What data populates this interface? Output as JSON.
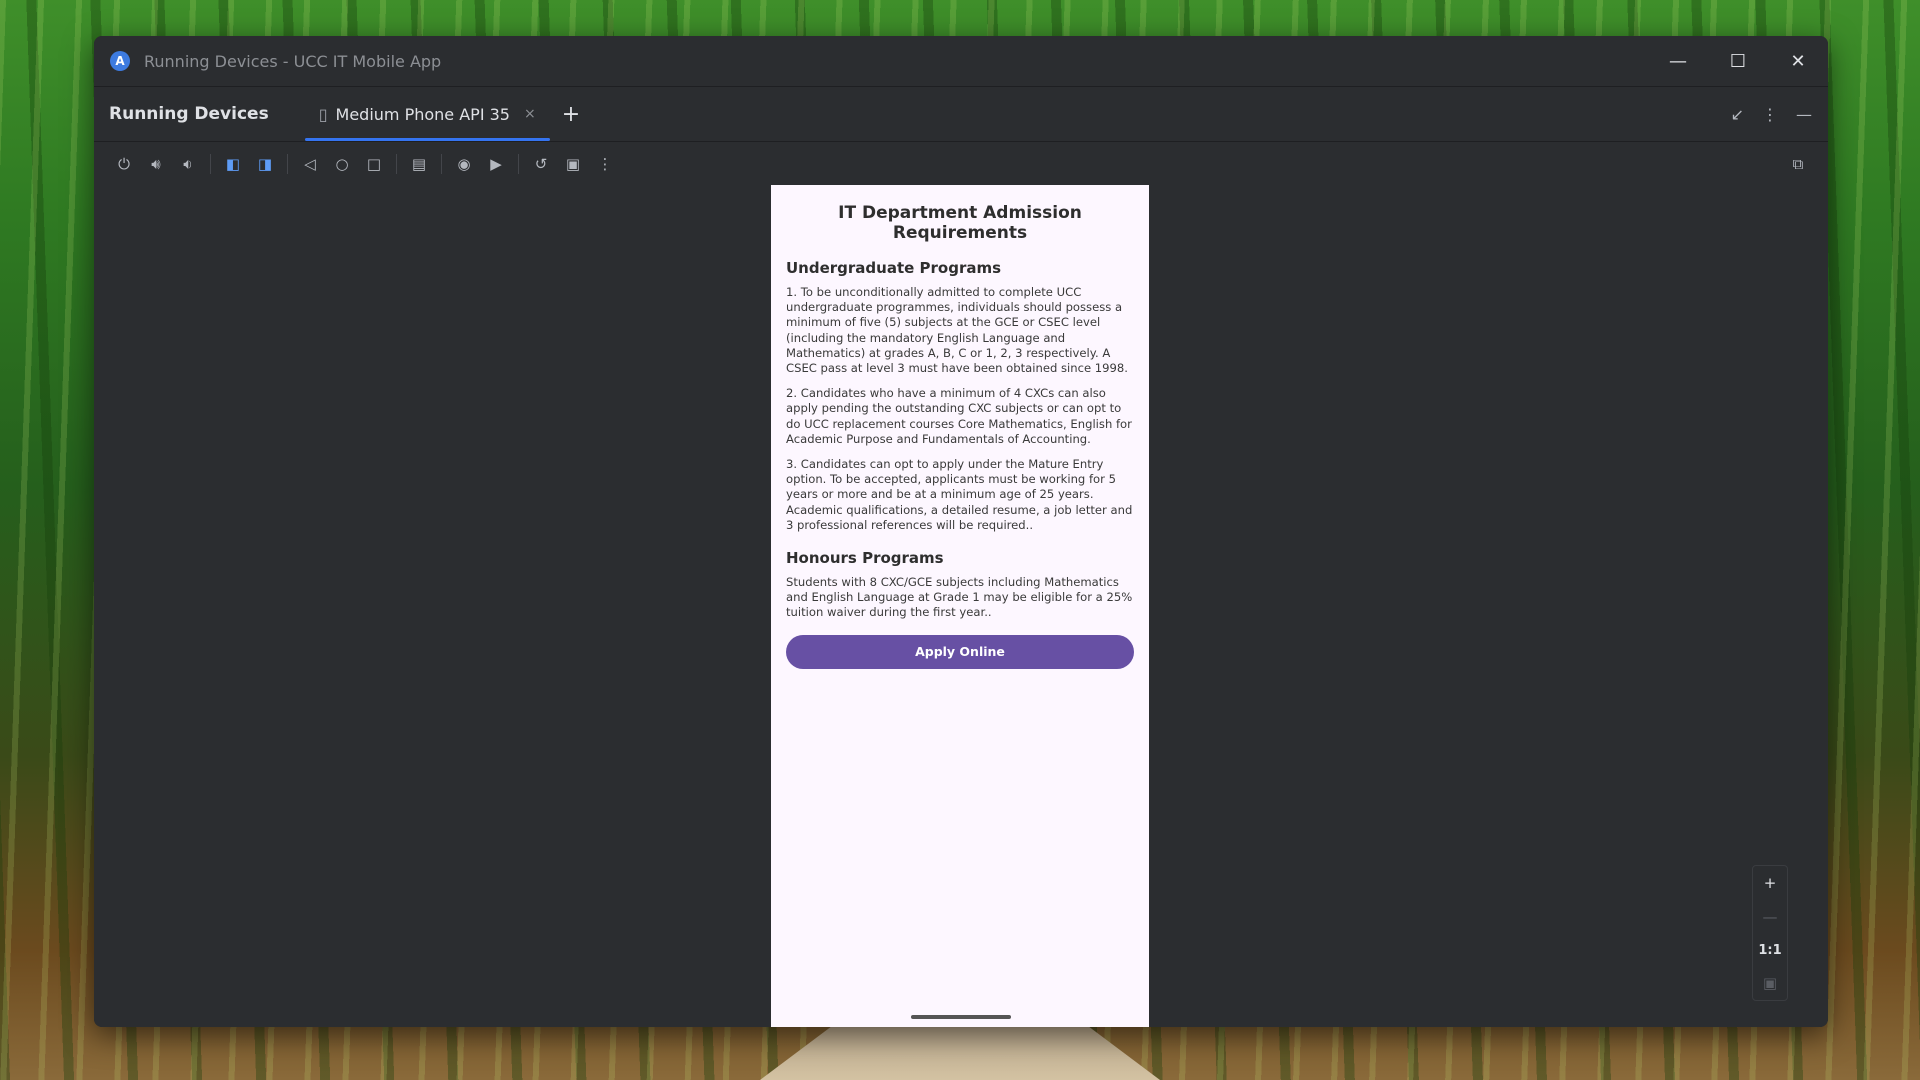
{
  "window": {
    "title": "Running Devices - UCC IT Mobile App",
    "logo_letter": "A",
    "controls": {
      "minimize": "—",
      "maximize": "☐",
      "close": "✕"
    }
  },
  "tabbar": {
    "panel_title": "Running Devices",
    "tab_label": "Medium Phone API 35",
    "tab_close": "×",
    "add_tab": "+",
    "right_icons": [
      "↙",
      "⋮",
      "—"
    ]
  },
  "toolbar": {
    "icons": [
      "power-icon",
      "volume-up-icon",
      "volume-down-icon",
      "rotate-left-icon",
      "rotate-right-icon",
      "back-icon",
      "home-icon",
      "overview-icon",
      "device-snapshot-icon",
      "screenshot-icon",
      "screen-record-icon",
      "reset-icon",
      "display-icon",
      "more-icon",
      "device-explorer-icon"
    ]
  },
  "phone": {
    "title": "IT Department Admission Requirements",
    "undergrad_heading": "Undergraduate Programs",
    "para1": "1. To be unconditionally admitted to complete UCC undergraduate programmes, individuals should possess a minimum of five (5) subjects at the GCE or CSEC level (including the mandatory English Language and Mathematics) at grades A, B, C or 1, 2, 3 respectively. A CSEC pass at level 3 must have been obtained since 1998.",
    "para2": "2. Candidates who have a minimum of 4 CXCs can also apply pending the outstanding CXC subjects or can opt to do UCC replacement courses Core Mathematics, English for Academic Purpose and Fundamentals of Accounting.",
    "para3": "3. Candidates can opt to apply under the Mature Entry option. To be accepted, applicants must be working for 5 years or more and be at a minimum age of 25 years. Academic qualifications, a detailed resume, a job letter and 3 professional references will be required..",
    "honours_heading": "Honours Programs",
    "honours_para": "Students with 8 CXC/GCE subjects including Mathematics and English Language at Grade 1 may be eligible for a 25% tuition waiver during the first year..",
    "apply_button": "Apply Online"
  },
  "zoom": {
    "zoom_in": "+",
    "zoom_out": "—",
    "actual_size": "1:1",
    "fit": "▣"
  }
}
